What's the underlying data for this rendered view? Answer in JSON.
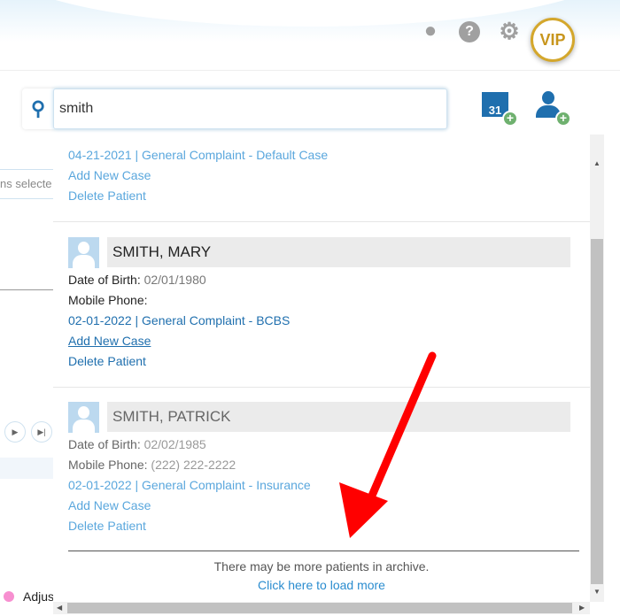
{
  "header": {
    "vip_label": "VIP",
    "icons": [
      "lightbulb-icon",
      "help-icon",
      "gear-icon"
    ]
  },
  "search": {
    "value": "smith",
    "icon": "search-icon"
  },
  "actions": {
    "calendar_day": "31"
  },
  "background": {
    "multiselect_text": "ns selecte",
    "legend_text": "Adjus",
    "legend_color": "#f78fd0"
  },
  "results": {
    "prev_entry": {
      "case": "04-21-2021 | General Complaint - Default Case",
      "add_case": "Add New Case",
      "delete": "Delete Patient"
    },
    "patients": [
      {
        "name": "SMITH, MARY",
        "dob_label": "Date of Birth:",
        "dob": "02/01/1980",
        "phone_label": "Mobile Phone:",
        "phone": "",
        "case": "02-01-2022 | General Complaint - BCBS",
        "add_case": "Add New Case",
        "delete": "Delete Patient"
      },
      {
        "name": "SMITH, PATRICK",
        "dob_label": "Date of Birth:",
        "dob": "02/02/1985",
        "phone_label": "Mobile Phone:",
        "phone": "(222) 222-2222",
        "case": "02-01-2022 | General Complaint - Insurance",
        "add_case": "Add New Case",
        "delete": "Delete Patient"
      }
    ],
    "archive_note": "There may be more patients in archive.",
    "load_more": "Click here to load more"
  },
  "colors": {
    "accent": "#1f6fae",
    "link": "#5aa7dd",
    "annotation_arrow": "#ff0000"
  }
}
